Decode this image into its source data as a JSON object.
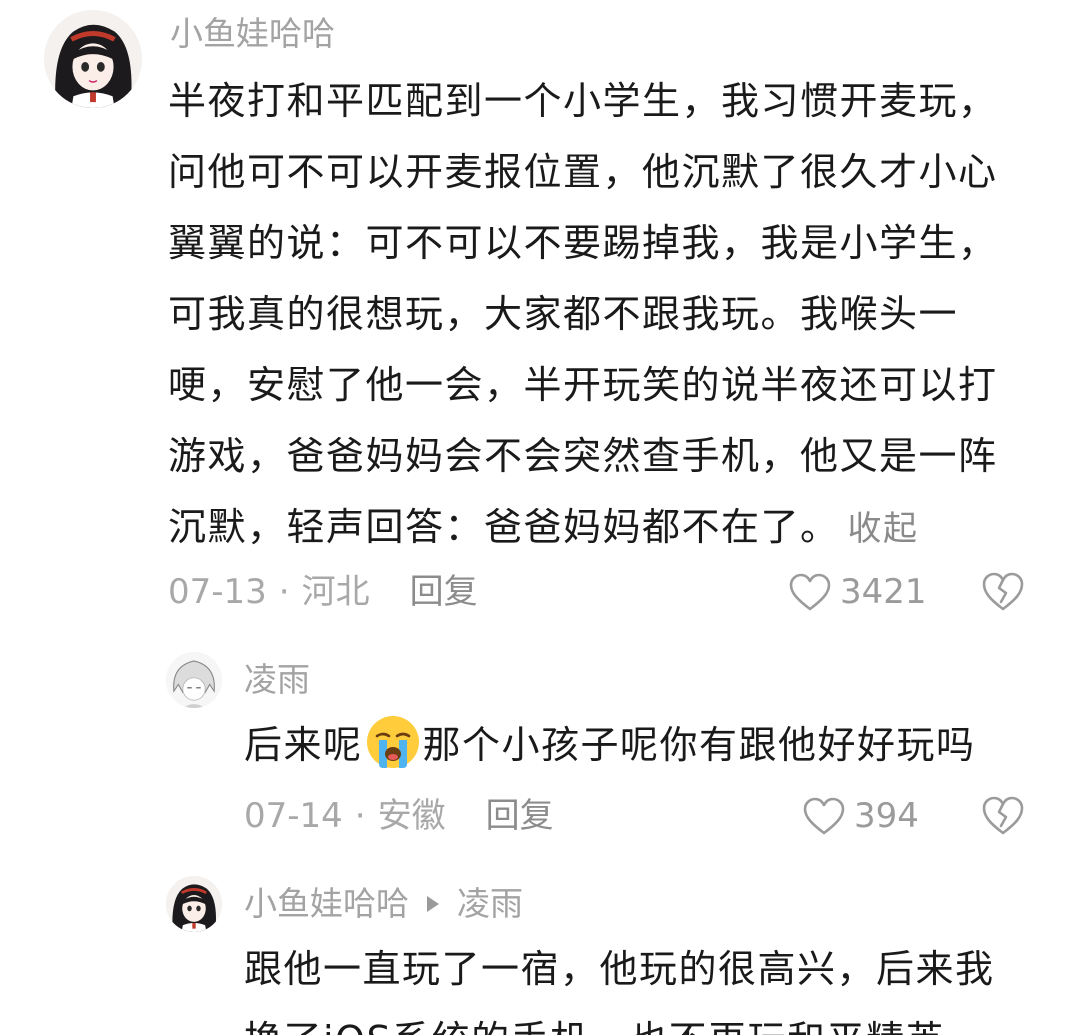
{
  "comment": {
    "username": "小鱼娃哈哈",
    "lines": [
      "半夜打和平匹配到一个小学生，我习惯开麦玩，",
      "问他可不可以开麦报位置，他沉默了很久才小心",
      "翼翼的说：可不可以不要踢掉我，我是小学生，",
      "可我真的很想玩，大家都不跟我玩。我喉头一",
      "哽，安慰了他一会，半开玩笑的说半夜还可以打",
      "游戏，爸爸妈妈会不会突然查手机，他又是一阵",
      "沉默，轻声回答：爸爸妈妈都不在了。"
    ],
    "collapse_label": "收起",
    "date": "07-13",
    "location": "河北",
    "reply_label": "回复",
    "likes": "3421"
  },
  "reply1": {
    "username": "凌雨",
    "text_before": "后来呢",
    "emoji": "crying-face",
    "text_after": "那个小孩子呢你有跟他好好玩吗",
    "date": "07-14",
    "location": "安徽",
    "reply_label": "回复",
    "likes": "394"
  },
  "reply2": {
    "username": "小鱼娃哈哈",
    "reply_to": "凌雨",
    "lines": [
      "跟他一直玩了一宿，他玩的很高兴，后来我",
      "换了iOS系统的手机，也不再玩和平精英"
    ]
  },
  "separator": "·"
}
